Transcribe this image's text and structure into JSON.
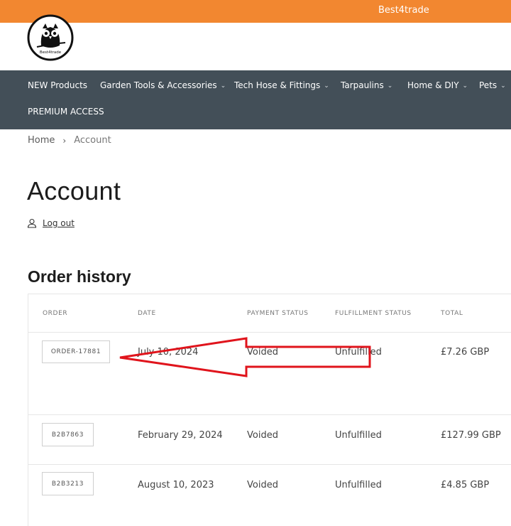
{
  "topbar": {
    "brand": "Best4trade"
  },
  "logo": {
    "text": "Best4trade"
  },
  "nav": {
    "items": [
      {
        "label": "NEW Products",
        "has_dropdown": false
      },
      {
        "label": "Garden Tools & Accessories",
        "has_dropdown": true
      },
      {
        "label": "Tech Hose & Fittings",
        "has_dropdown": true
      },
      {
        "label": "Tarpaulins",
        "has_dropdown": true
      },
      {
        "label": "Home & DIY",
        "has_dropdown": true
      },
      {
        "label": "Pets",
        "has_dropdown": true
      },
      {
        "label": "PREMIUM ACCESS",
        "has_dropdown": false
      }
    ]
  },
  "breadcrumb": {
    "home": "Home",
    "separator": "›",
    "current": "Account"
  },
  "page": {
    "title": "Account"
  },
  "logout": {
    "label": "Log out",
    "icon": "user-icon"
  },
  "orders": {
    "title": "Order history",
    "columns": [
      "ORDER",
      "DATE",
      "PAYMENT STATUS",
      "FULFILLMENT STATUS",
      "TOTAL"
    ],
    "rows": [
      {
        "order": "ORDER-17881",
        "date": "July 10, 2024",
        "payment": "Voided",
        "fulfillment": "Unfulfilled",
        "total": "£7.26 GBP"
      },
      {
        "order": "B2B7863",
        "date": "February 29, 2024",
        "payment": "Voided",
        "fulfillment": "Unfulfilled",
        "total": "£127.99 GBP"
      },
      {
        "order": "B2B3213",
        "date": "August 10, 2023",
        "payment": "Voided",
        "fulfillment": "Unfulfilled",
        "total": "£4.85 GBP"
      }
    ]
  },
  "colors": {
    "topbar": "#f28730",
    "nav": "#434f58",
    "annotation": "#e0141c"
  }
}
